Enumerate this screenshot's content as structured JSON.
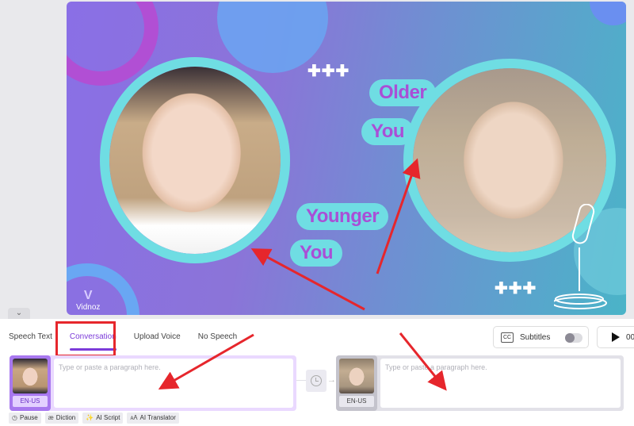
{
  "preview": {
    "labels": {
      "younger_line1": "Younger",
      "younger_line2": "You",
      "older_line1": "Older",
      "older_line2": "You",
      "crosses": "✚✚✚"
    },
    "brand": {
      "logo": "V",
      "name": "Vidnoz"
    },
    "colors": {
      "ring": "#6fdde3",
      "label_text": "#a94fd6"
    }
  },
  "collapse_icon": "⌄",
  "tabs": [
    {
      "label": "Speech Text",
      "active": false
    },
    {
      "label": "Conversation",
      "active": true
    },
    {
      "label": "Upload Voice",
      "active": false
    },
    {
      "label": "No Speech",
      "active": false
    }
  ],
  "subtitles": {
    "icon": "CC",
    "label": "Subtitles",
    "enabled": false
  },
  "play": {
    "label": "00"
  },
  "speakers": [
    {
      "language": "EN-US",
      "placeholder": "Type or paste a paragraph here.",
      "value": ""
    },
    {
      "language": "EN-US",
      "placeholder": "Type or paste a paragraph here.",
      "value": ""
    }
  ],
  "tools": [
    {
      "icon": "◷",
      "label": "Pause"
    },
    {
      "icon": "æ",
      "label": "Diction"
    },
    {
      "icon": "✨",
      "label": "AI Script"
    },
    {
      "icon": "🗚",
      "label": "AI Translator"
    }
  ],
  "annotation_colors": {
    "highlight": "#e6262c",
    "accent": "#7c3bd9"
  }
}
